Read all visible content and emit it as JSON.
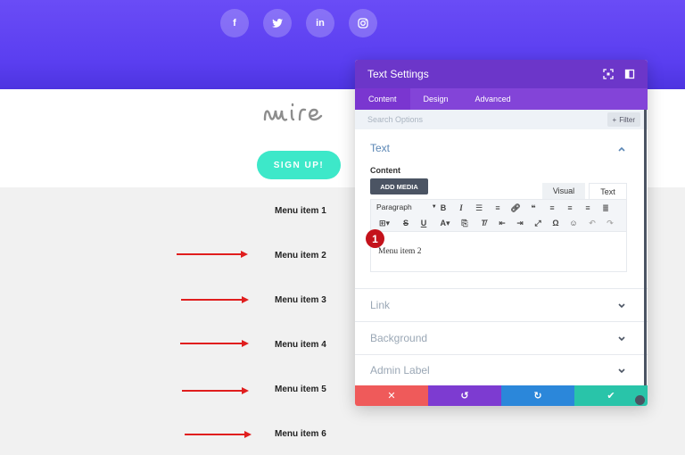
{
  "social": [
    {
      "name": "facebook",
      "glyph": "f"
    },
    {
      "name": "twitter",
      "glyph": "t"
    },
    {
      "name": "linkedin",
      "glyph": "in"
    },
    {
      "name": "instagram",
      "glyph": "◎"
    }
  ],
  "logo": {
    "text": "suire"
  },
  "signup": {
    "label": "SIGN UP!"
  },
  "menu": {
    "items": [
      "Menu item 1",
      "Menu item 2",
      "Menu item 3",
      "Menu item 4",
      "Menu item 5",
      "Menu item 6"
    ]
  },
  "panel": {
    "title": "Text Settings",
    "tabs": [
      "Content",
      "Design",
      "Advanced"
    ],
    "search_placeholder": "Search Options",
    "filter_label": "Filter",
    "text_section": "Text",
    "content_label": "Content",
    "add_media": "ADD MEDIA",
    "mode_visual": "Visual",
    "mode_text": "Text",
    "paragraph": "Paragraph",
    "editor_value": "Menu item 2",
    "step_badge": "1",
    "sections": [
      "Link",
      "Background",
      "Admin Label"
    ]
  },
  "colors": {
    "hero": "#5a3ef0",
    "accent": "#3de8c9",
    "panel_header": "#6c36c9",
    "cancel": "#ef5a5a",
    "undo": "#7d3bd1",
    "redo": "#2b87da",
    "save": "#29c4a9"
  }
}
